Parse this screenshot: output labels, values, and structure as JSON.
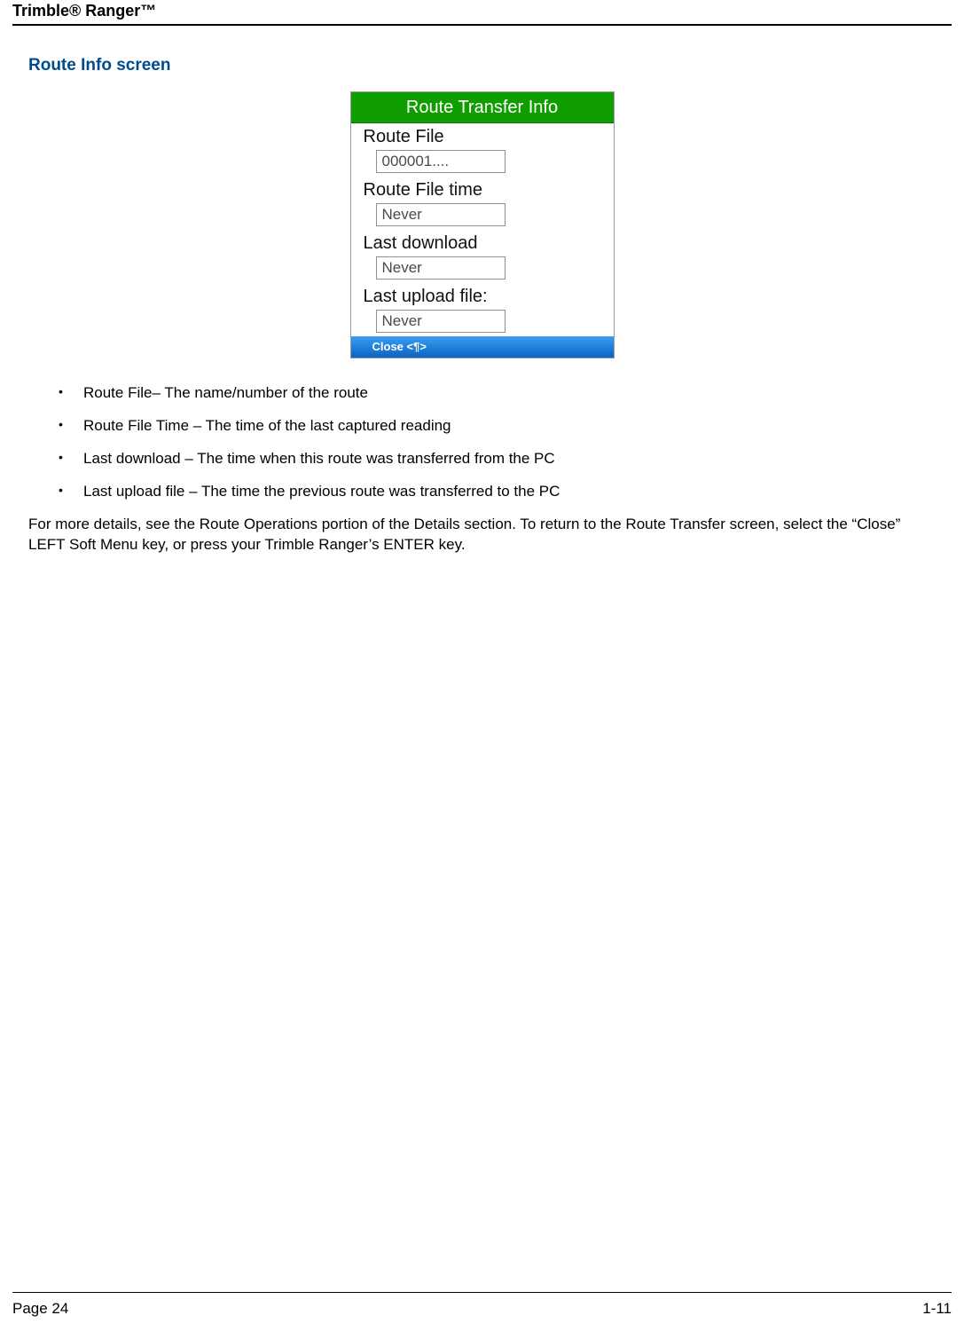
{
  "header": {
    "title": "Trimble® Ranger™"
  },
  "section": {
    "title": "Route Info screen"
  },
  "device": {
    "titlebar": "Route Transfer Info",
    "fields": [
      {
        "label": "Route File",
        "value": "000001...."
      },
      {
        "label": "Route File time",
        "value": "Never"
      },
      {
        "label": "Last download",
        "value": "Never"
      },
      {
        "label": "Last upload file:",
        "value": "Never"
      }
    ],
    "softkey_left": "Close <¶>"
  },
  "bullets": [
    "Route File– The name/number of the route",
    "Route File Time – The time of the last captured reading",
    "Last download – The time when this route was transferred from the PC",
    "Last upload file – The time the previous route was transferred to the PC"
  ],
  "paragraph": "For more details, see the Route Operations portion of the Details section.  To return to the Route Transfer screen, select the “Close” LEFT Soft Menu key, or press your Trimble Ranger’s ENTER key.",
  "footer": {
    "left": "Page 24",
    "right": "1-11"
  }
}
